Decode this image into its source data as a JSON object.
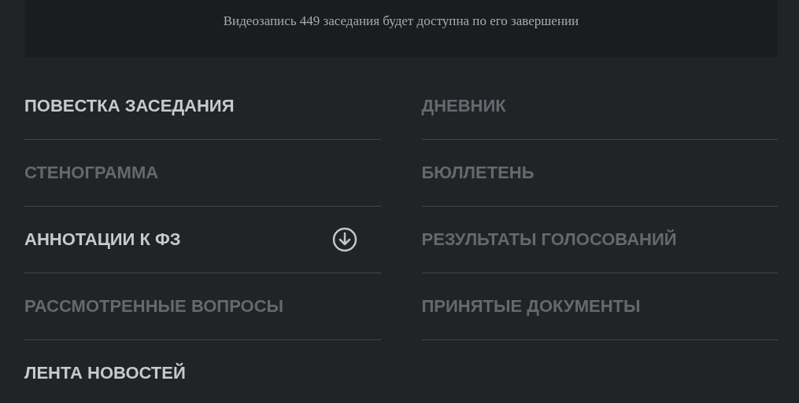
{
  "notice": "Видеозапись 449 заседания будет доступна по его завершении",
  "left_items": [
    {
      "label": "ПОВЕСТКА ЗАСЕДАНИЯ",
      "disabled": false,
      "downloadable": false
    },
    {
      "label": "СТЕНОГРАММА",
      "disabled": true,
      "downloadable": false
    },
    {
      "label": "АННОТАЦИИ К ФЗ",
      "disabled": false,
      "downloadable": true
    },
    {
      "label": "РАССМОТРЕННЫЕ ВОПРОСЫ",
      "disabled": true,
      "downloadable": false
    },
    {
      "label": "ЛЕНТА НОВОСТЕЙ",
      "disabled": false,
      "downloadable": false
    }
  ],
  "right_items": [
    {
      "label": "ДНЕВНИК",
      "disabled": true,
      "downloadable": false
    },
    {
      "label": "БЮЛЛЕТЕНЬ",
      "disabled": true,
      "downloadable": false
    },
    {
      "label": "РЕЗУЛЬТАТЫ ГОЛОСОВАНИЙ",
      "disabled": true,
      "downloadable": false
    },
    {
      "label": "ПРИНЯТЫЕ ДОКУМЕНТЫ",
      "disabled": true,
      "downloadable": false
    }
  ]
}
